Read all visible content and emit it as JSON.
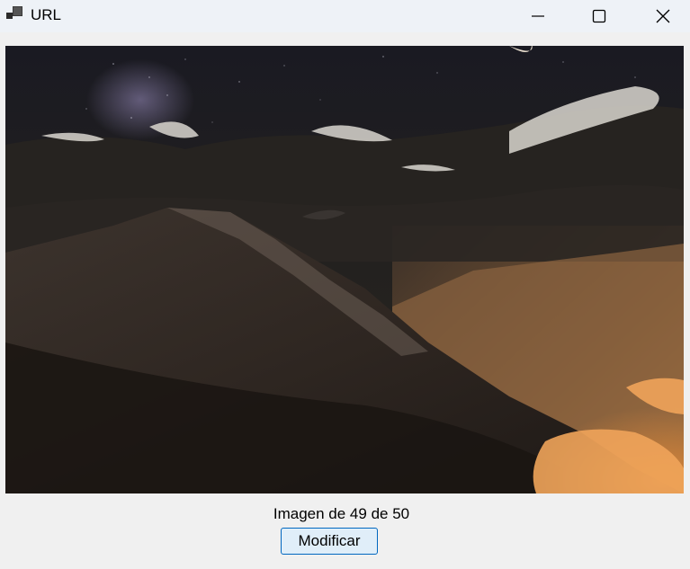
{
  "window": {
    "title": "URL",
    "icon": "app-window-icon",
    "controls": [
      "minimize-icon",
      "maximize-icon",
      "close-icon"
    ]
  },
  "viewer": {
    "image_description_icon": "landscape-photo",
    "caption": "Imagen de 49 de 50",
    "current_index": 49,
    "total": 50
  },
  "actions": {
    "modify_label": "Modificar"
  },
  "colors": {
    "titlebar": "#eef2f7",
    "window_bg": "#f0f0f0",
    "button_bg": "#e0eef9",
    "button_border": "#0067c0"
  }
}
